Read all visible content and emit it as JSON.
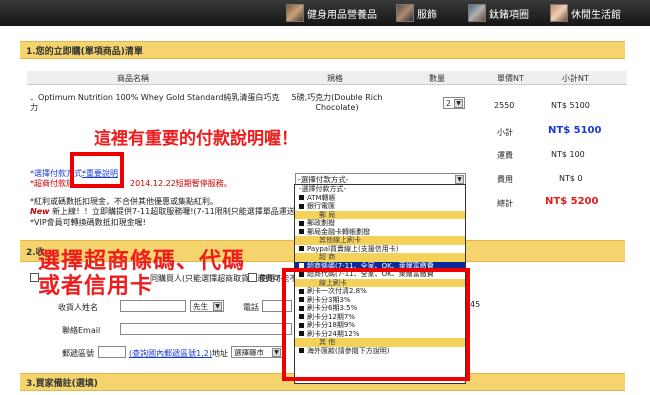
{
  "topnav": [
    {
      "label": "健身用品營養品"
    },
    {
      "label": "服飾"
    },
    {
      "label": "鈦鍺項圈"
    },
    {
      "label": "休閒生活館"
    }
  ],
  "section1": {
    "title": "1.您的立即購(單項商品)清單",
    "headers": [
      "商品名稱",
      "規格",
      "數量",
      "單價NT",
      "小計NT"
    ],
    "item": {
      "name": "．Optimum Nutrition 100% Whey Gold Standard純乳清蛋白巧克力",
      "spec": "5磅,巧克力(Double Rich Chocolate)",
      "qty": "2",
      "unit_price": "2550",
      "subtotal": "NT$ 5100"
    },
    "subtotal_label": "小計",
    "subtotal_value": "NT$ 5100",
    "shipping_label": "運費",
    "shipping_value": "NT$ 100",
    "fee_label": "費用",
    "fee_value": "NT$ 0",
    "total_label": "總計",
    "total_value": "NT$ 5200"
  },
  "payment": {
    "choose_label": "*選擇付款方式:",
    "explain_link": "*重要說明",
    "notice_prefix": "*超商付款於",
    "notice_suffix": "2014.12.22短期暫停服務。",
    "select_value": "-選擇付款方式-",
    "note1": "*紅利或碼數抵扣現金，不合併其他優惠或集點紅利。",
    "note2_new": "New",
    "note2": "新上線！！立即購提供7-11超取服務囉!(7-11限制只能選擇單品運送,還送",
    "note3": "*VIP會員可轉換碼數抵扣現金喔!"
  },
  "dropdown_options": [
    {
      "label": "-選擇付款方式-",
      "type": "plain"
    },
    {
      "label": "ATM轉帳",
      "type": "item"
    },
    {
      "label": "銀行電匯",
      "type": "item"
    },
    {
      "label": "郵  局",
      "type": "group"
    },
    {
      "label": "郵政劃撥",
      "type": "item"
    },
    {
      "label": "郵局金融卡轉帳劃撥",
      "type": "item"
    },
    {
      "label": "其他線上刷卡",
      "type": "group"
    },
    {
      "label": "Paypal買賣線上(支援信用卡)",
      "type": "item"
    },
    {
      "label": "超  商",
      "type": "group"
    },
    {
      "label": "超商條碼(7-11、全家、OK、萊爾富繳費",
      "type": "selected"
    },
    {
      "label": "超商代碼(7-11、全家、OK、萊爾富繳費",
      "type": "item"
    },
    {
      "label": "線上刷卡",
      "type": "group"
    },
    {
      "label": "刷卡一次付清2.8%",
      "type": "item"
    },
    {
      "label": "刷卡分3期3%",
      "type": "item"
    },
    {
      "label": "刷卡分6期3.5%",
      "type": "item"
    },
    {
      "label": "刷卡分12期7%",
      "type": "item"
    },
    {
      "label": "刷卡分18期9%",
      "type": "item"
    },
    {
      "label": "刷卡分24期12%",
      "type": "item"
    },
    {
      "label": "其  他",
      "type": "group"
    },
    {
      "label": "海外匯款(請參閱下方說明)",
      "type": "item"
    }
  ],
  "section2": {
    "title": "2.收",
    "checkbox1": "同購買人(只能選擇超商取貨且運費可能不同)",
    "checkbox2": "使用7-",
    "name_label": "收貨人姓名",
    "title_select": "先生",
    "phone_label": "電話",
    "phone_suffix": "45",
    "email_label": "聯絡Email",
    "zip_label": "郵遞區號",
    "zip_link": "(查詢國內郵遞區號1,2)",
    "address_label": "地址",
    "city_select": "選擇縣市"
  },
  "section3": {
    "title": "3.買家備註(選填)"
  },
  "annotations": {
    "top": "這裡有重要的付款說明喔！",
    "left_line1": "選擇超商條碼、代碼",
    "left_line2": "或者信用卡"
  },
  "colors": {
    "section_bar": "#f5d46e",
    "annotation_red": "#ee1c1c",
    "selected_option": "#0a2a9a",
    "price_blue": "#1a3ad8"
  }
}
